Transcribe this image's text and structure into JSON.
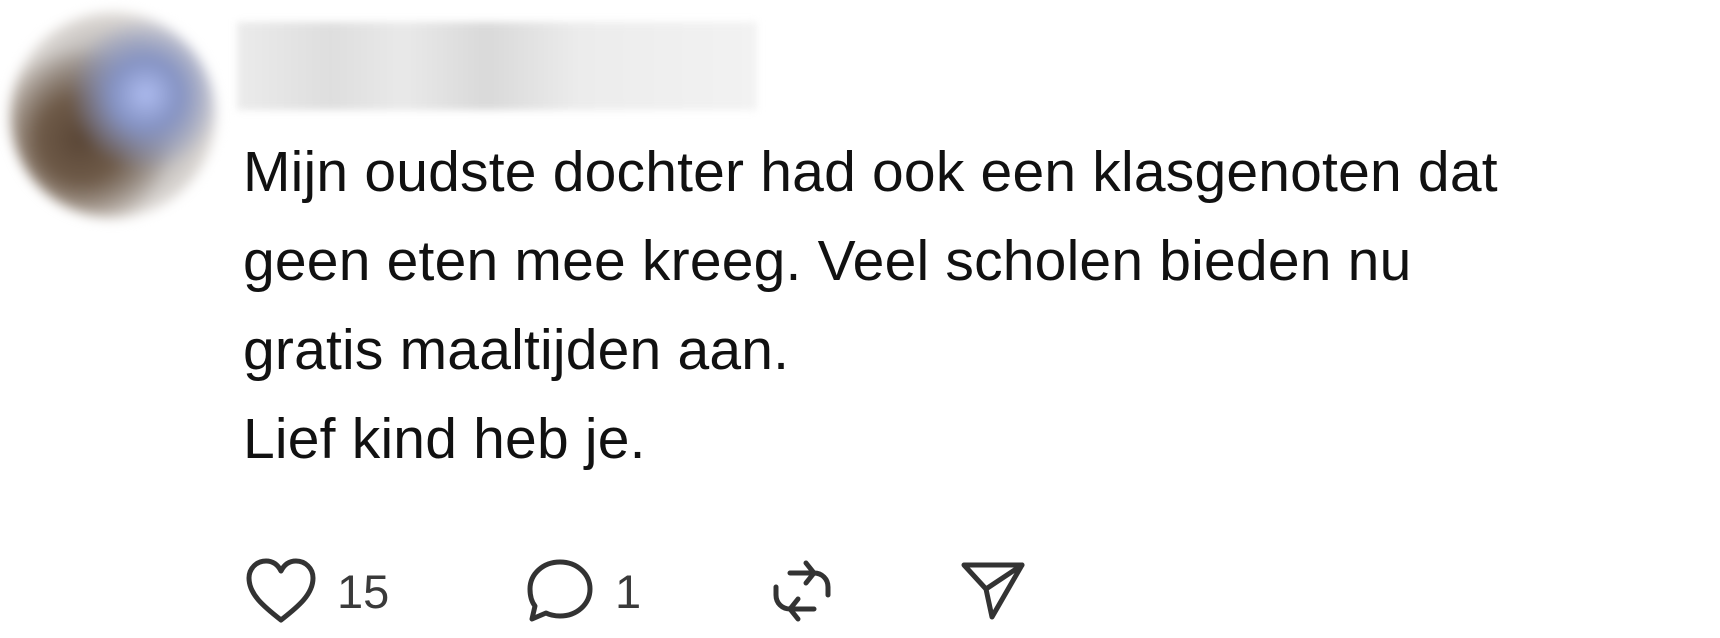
{
  "post": {
    "author": {
      "name": "",
      "avatar_blurred": true,
      "name_blurred": true
    },
    "body_lines": [
      "Mijn oudste dochter had ook een klasgenoten dat",
      "geen eten mee kreeg. Veel scholen bieden nu",
      "gratis maaltijden aan.",
      "Lief kind heb je."
    ],
    "actions": {
      "like": {
        "icon": "heart-icon",
        "count": "15"
      },
      "reply": {
        "icon": "speech-bubble-icon",
        "count": "1"
      },
      "repost": {
        "icon": "repost-icon"
      },
      "share": {
        "icon": "send-icon"
      }
    }
  },
  "colors": {
    "background": "#ffffff",
    "text": "#111111",
    "icon": "#333333",
    "count": "#3a3a3a"
  }
}
